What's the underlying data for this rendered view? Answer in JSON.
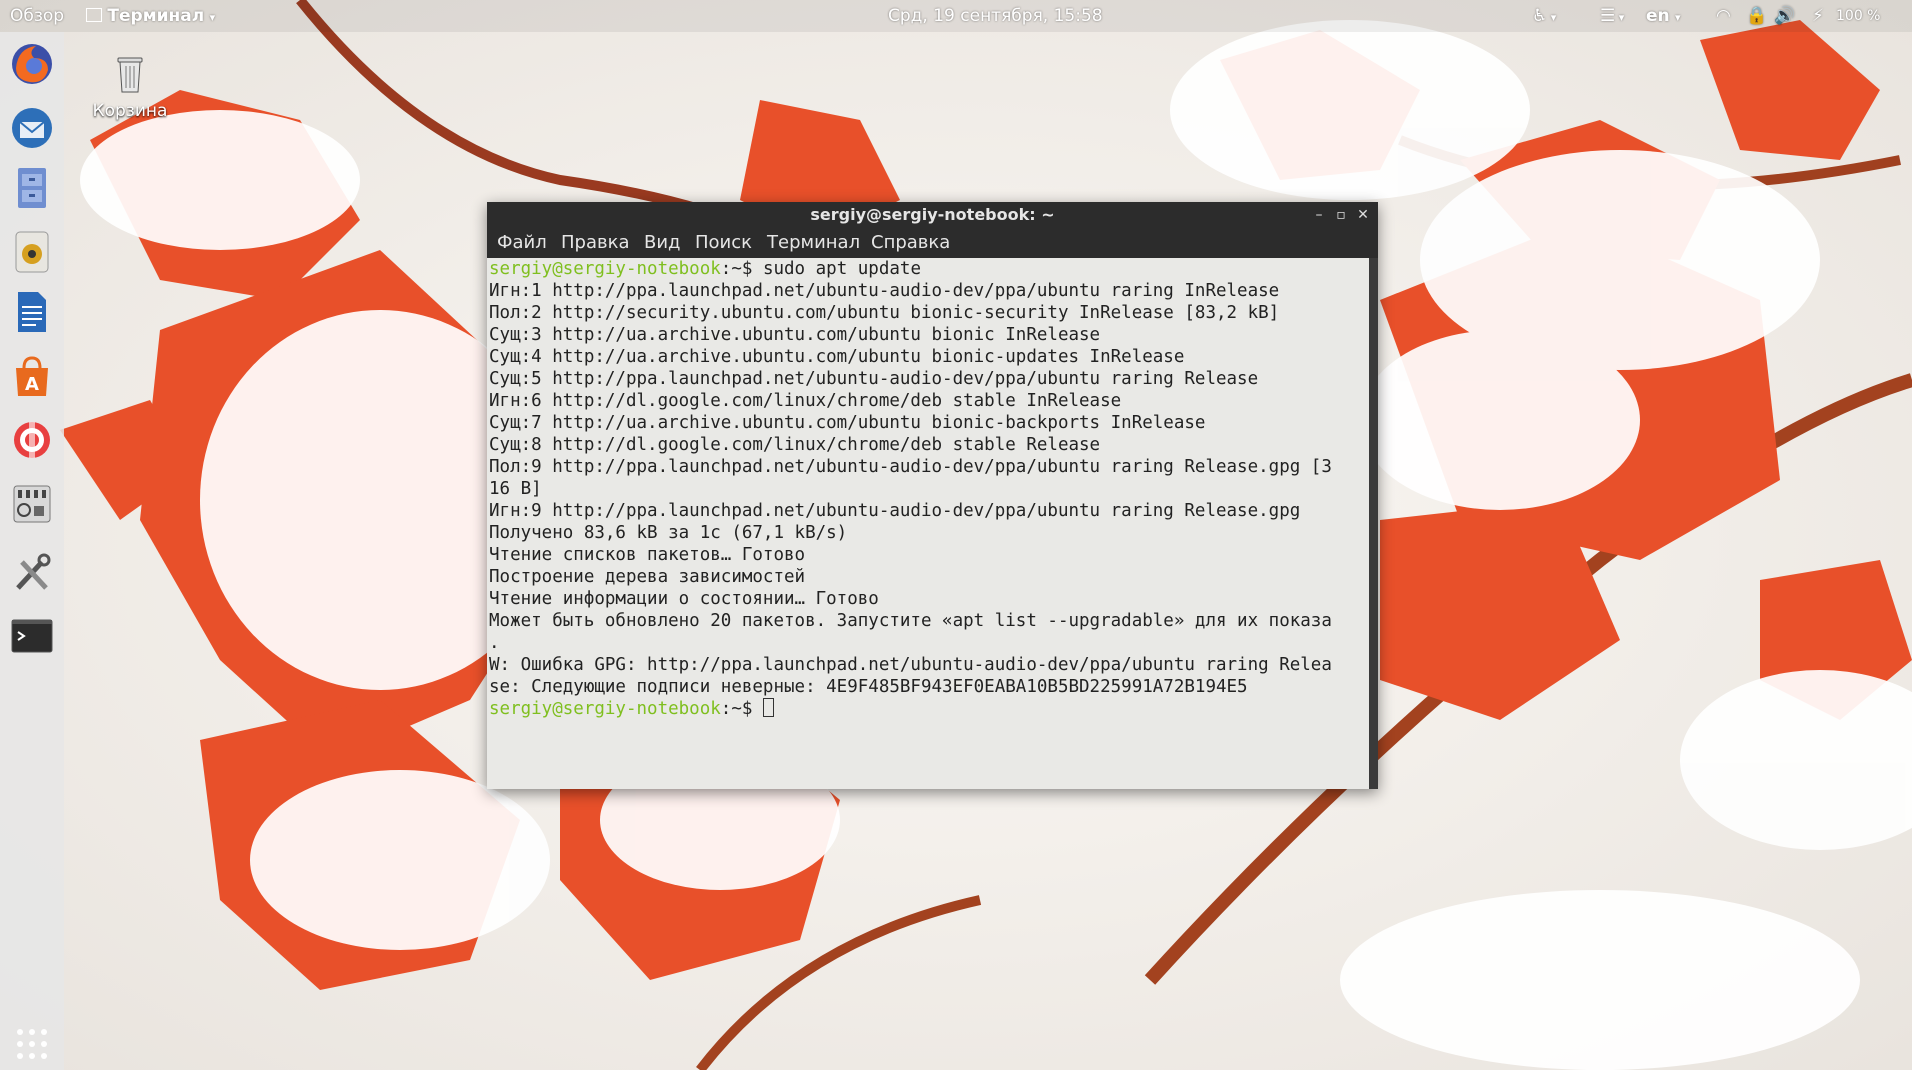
{
  "topbar": {
    "activities": "Обзор",
    "app_name": "Терминал",
    "clock": "Срд, 19 сентября, 15:58",
    "language": "en",
    "battery": "100 %"
  },
  "desktop": {
    "trash_label": "Корзина"
  },
  "dock": {
    "items": [
      "firefox-icon",
      "thunderbird-icon",
      "files-icon",
      "rhythmbox-icon",
      "libreoffice-writer-icon",
      "software-center-icon",
      "help-icon",
      "system-monitor-icon",
      "settings-tools-icon",
      "terminal-icon",
      "show-apps-icon"
    ]
  },
  "terminal": {
    "title": "sergiy@sergiy-notebook: ~",
    "menu": [
      "Файл",
      "Правка",
      "Вид",
      "Поиск",
      "Терминал",
      "Справка"
    ],
    "prompt_user": "sergiy@sergiy-notebook",
    "prompt_path": ":~$ ",
    "command": "sudo apt update",
    "output": [
      "Игн:1 http://ppa.launchpad.net/ubuntu-audio-dev/ppa/ubuntu raring InRelease",
      "Пол:2 http://security.ubuntu.com/ubuntu bionic-security InRelease [83,2 kB]",
      "Сущ:3 http://ua.archive.ubuntu.com/ubuntu bionic InRelease",
      "Сущ:4 http://ua.archive.ubuntu.com/ubuntu bionic-updates InRelease",
      "Сущ:5 http://ppa.launchpad.net/ubuntu-audio-dev/ppa/ubuntu raring Release",
      "Игн:6 http://dl.google.com/linux/chrome/deb stable InRelease",
      "Сущ:7 http://ua.archive.ubuntu.com/ubuntu bionic-backports InRelease",
      "Сущ:8 http://dl.google.com/linux/chrome/deb stable Release",
      "Пол:9 http://ppa.launchpad.net/ubuntu-audio-dev/ppa/ubuntu raring Release.gpg [3",
      "16 B]",
      "Игн:9 http://ppa.launchpad.net/ubuntu-audio-dev/ppa/ubuntu raring Release.gpg",
      "Получено 83,6 kB за 1с (67,1 kB/s)",
      "Чтение списков пакетов… Готово",
      "Построение дерева зависимостей",
      "Чтение информации о состоянии… Готово",
      "Может быть обновлено 20 пакетов. Запустите «apt list --upgradable» для их показа",
      ".",
      "W: Ошибка GPG: http://ppa.launchpad.net/ubuntu-audio-dev/ppa/ubuntu raring Relea",
      "se: Следующие подписи неверные: 4E9F485BF943EF0EABA10B5BD225991A72B194E5"
    ]
  },
  "colors": {
    "prompt": "#7fbf1f",
    "leaf": "#e8502a",
    "snow": "#ffffff"
  }
}
